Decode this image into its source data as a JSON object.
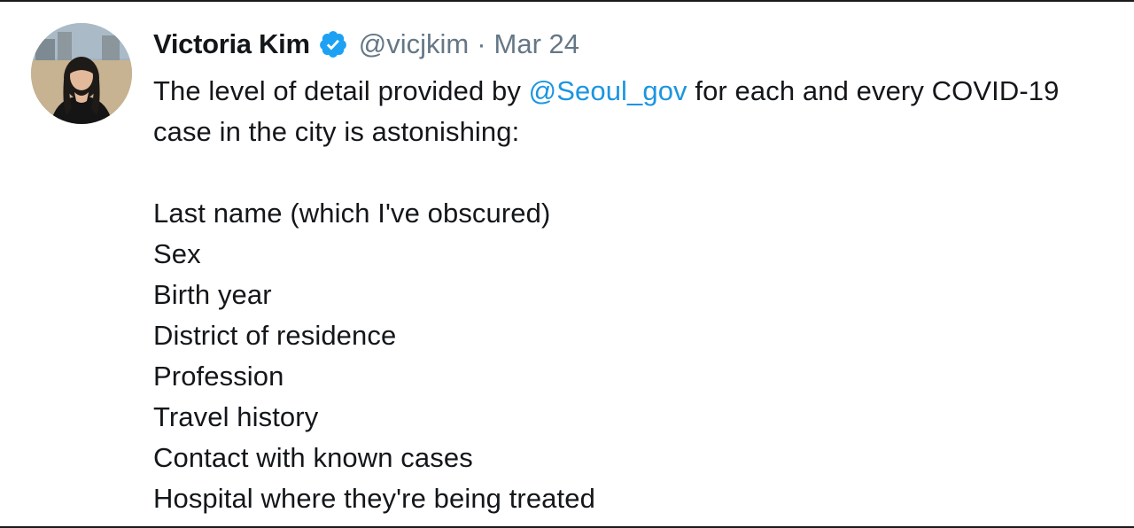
{
  "tweet": {
    "author": {
      "display_name": "Victoria Kim",
      "handle": "@vicjkim",
      "verified": true,
      "avatar_icon": "profile-photo"
    },
    "separator": "·",
    "date": "Mar 24",
    "body": {
      "line1_prefix": "The level of detail provided by ",
      "line1_mention": "@Seoul_gov",
      "line1_suffix": " for each and every COVID-19",
      "line2": "case in the city is astonishing:",
      "list_items": [
        "Last name (which I've obscured)",
        "Sex",
        "Birth year",
        "District of residence",
        "Profession",
        "Travel history",
        "Contact with known cases",
        "Hospital where they're being treated"
      ]
    }
  },
  "colors": {
    "text": "#14171a",
    "secondary": "#657786",
    "link": "#1b95e0",
    "verified_badge": "#1da1f2"
  }
}
